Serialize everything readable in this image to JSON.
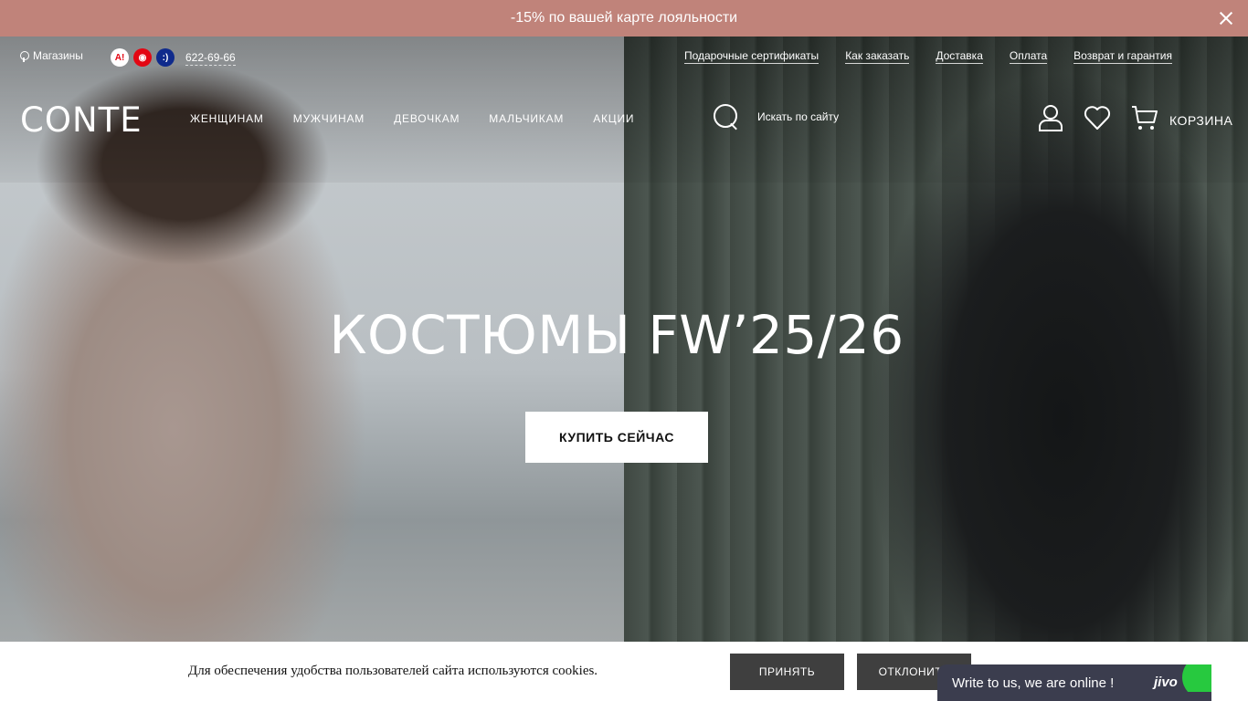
{
  "promo": {
    "text": "-15% по вашей карте лояльности",
    "close_icon": "close-icon"
  },
  "header": {
    "stores_label": "Магазины",
    "operators": [
      "A1",
      "МТС",
      "life:)"
    ],
    "operator_glyphs": [
      "A!",
      "◉",
      ":)"
    ],
    "phone": "622-69-66",
    "links": [
      "Подарочные сертификаты",
      "Как заказать",
      "Доставка",
      "Оплата",
      "Возврат и гарантия"
    ],
    "logo": "CONTE",
    "nav": [
      "ЖЕНЩИНАМ",
      "МУЖЧИНАМ",
      "ДЕВОЧКАМ",
      "МАЛЬЧИКАМ",
      "АКЦИИ"
    ],
    "search_placeholder": "Искать по сайту",
    "cart_label": "КОРЗИНА"
  },
  "hero": {
    "title": "КОСТЮМЫ FW’25/26",
    "cta": "КУПИТЬ СЕЙЧАС"
  },
  "cookie": {
    "text": "Для обеспечения удобства пользователей сайта используются cookies.",
    "accept": "ПРИНЯТЬ",
    "decline": "ОТКЛОНИТЬ"
  },
  "chat": {
    "text": "Write to us, we are online !",
    "brand": "jivo"
  },
  "colors": {
    "promo_bg": "#c0837a",
    "button_dark": "#3f3f3f",
    "chat_bg": "#3b3d4e",
    "online_green": "#27c93f"
  }
}
